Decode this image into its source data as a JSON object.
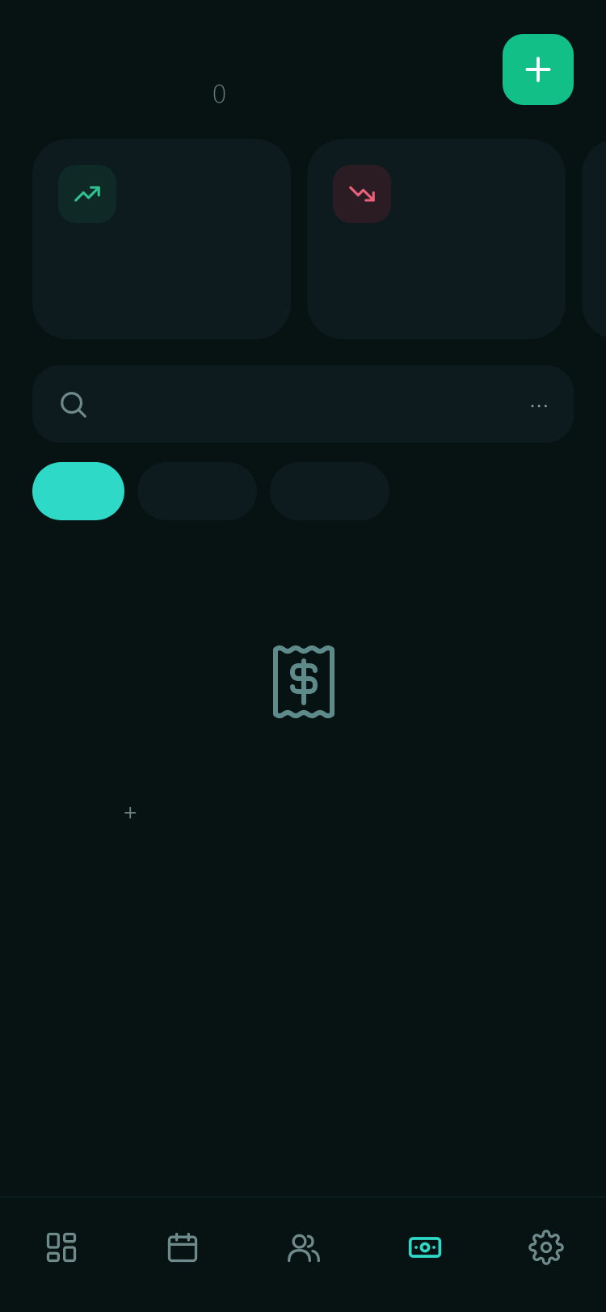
{
  "header": {
    "count": "0"
  },
  "fab": {
    "icon": "plus-icon",
    "color": "#12bf86"
  },
  "cards": [
    {
      "icon": "trending-up-icon",
      "color": "#2fc08f"
    },
    {
      "icon": "trending-down-icon",
      "color": "#e8607a"
    },
    {
      "icon": ""
    }
  ],
  "search": {
    "icon": "search-icon",
    "value": "",
    "more_label": "..."
  },
  "filters": {
    "active_color": "#2fd9c7",
    "items": [
      {
        "label": "",
        "active": true
      },
      {
        "label": "",
        "active": false
      },
      {
        "label": "",
        "active": false
      }
    ]
  },
  "empty_state": {
    "icon": "receipt-dollar-icon",
    "add_hint": "+"
  },
  "bottom_nav": {
    "active_color": "#2fd9c7",
    "items": [
      {
        "icon": "dashboard-icon",
        "active": false
      },
      {
        "icon": "calendar-icon",
        "active": false
      },
      {
        "icon": "users-icon",
        "active": false
      },
      {
        "icon": "banknote-icon",
        "active": true
      },
      {
        "icon": "gear-icon",
        "active": false
      }
    ]
  }
}
